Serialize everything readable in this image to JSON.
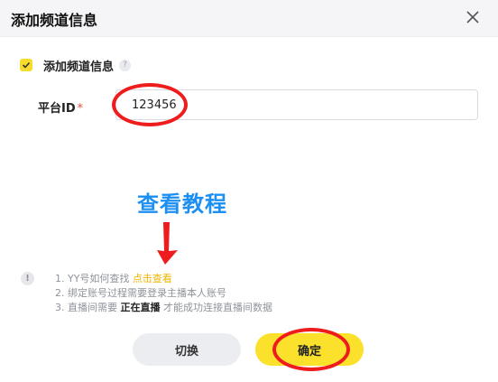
{
  "dialog": {
    "title": "添加频道信息"
  },
  "section": {
    "label": "添加频道信息",
    "checked": true,
    "help_icon": "?"
  },
  "form": {
    "platform_label": "平台ID",
    "required_mark": "*",
    "platform_value": "123456"
  },
  "annotation": {
    "tutorial_text": "查看教程"
  },
  "tips": {
    "icon": "!",
    "line1_prefix": "1. YY号如何查找",
    "line1_link": "点击查看",
    "line2": "2. 绑定账号过程需要登录主播本人账号",
    "line3_prefix": "3. 直播间需要",
    "line3_bold": "正在直播",
    "line3_suffix": "才能成功连接直播间数据"
  },
  "buttons": {
    "switch_label": "切换",
    "confirm_label": "确定"
  },
  "colors": {
    "accent": "#fbe12c",
    "link": "#f0b400",
    "annotation_red": "#ee1c1c",
    "annotation_blue": "#1d8ff2"
  }
}
